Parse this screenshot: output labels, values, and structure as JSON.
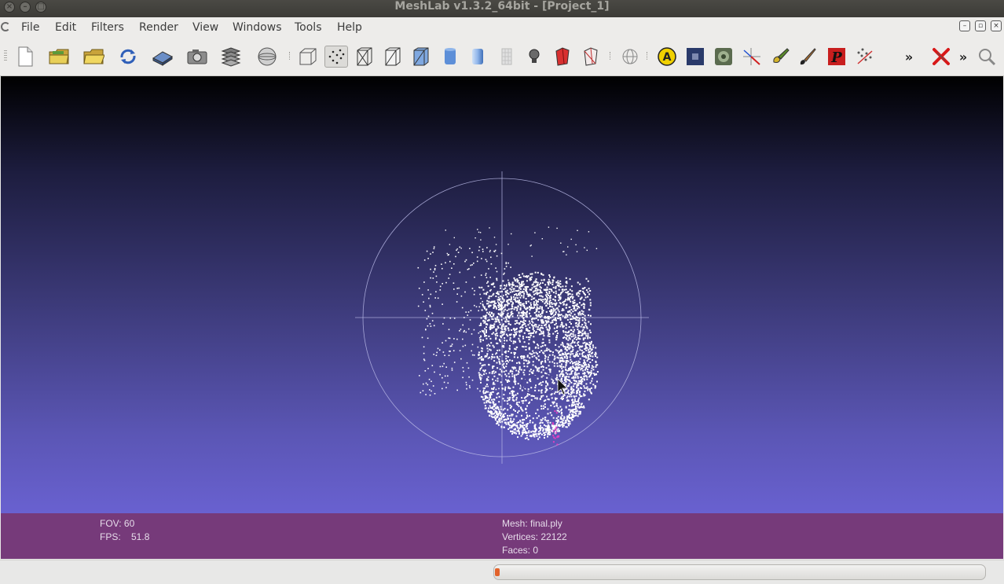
{
  "window": {
    "title": "MeshLab v1.3.2_64bit - [Project_1]"
  },
  "menu": {
    "items": [
      {
        "label": "File"
      },
      {
        "label": "Edit"
      },
      {
        "label": "Filters"
      },
      {
        "label": "Render"
      },
      {
        "label": "View"
      },
      {
        "label": "Windows"
      },
      {
        "label": "Tools"
      },
      {
        "label": "Help"
      }
    ]
  },
  "toolbar": {
    "buttons": [
      "new-project",
      "open-project",
      "import-mesh",
      "reload",
      "save",
      "snapshot",
      "show-layers",
      "decorate",
      "bounding-box",
      "points",
      "wireframe",
      "hidden-lines",
      "flat-lines",
      "flat",
      "smooth",
      "texture",
      "lighting",
      "back-face",
      "double-side",
      "select-faces",
      "annotate",
      "texture-image",
      "sample-color",
      "align",
      "paint-brush",
      "paint",
      "pickpoints",
      "more",
      "delete",
      "more",
      "search"
    ],
    "overflow_label": "»"
  },
  "viewport": {
    "colors": {
      "background_top": "#000000",
      "background_bottom": "#6961d0",
      "points": "#ffffff",
      "trackball": "#b8b8e6",
      "selected_points": "#e040c0"
    }
  },
  "info": {
    "fov": "FOV: 60",
    "fps": "FPS:    51.8",
    "mesh": "Mesh: final.ply",
    "vertices": "Vertices: 22122",
    "faces": "Faces: 0"
  },
  "status": {
    "progress_fraction": 0.01
  }
}
